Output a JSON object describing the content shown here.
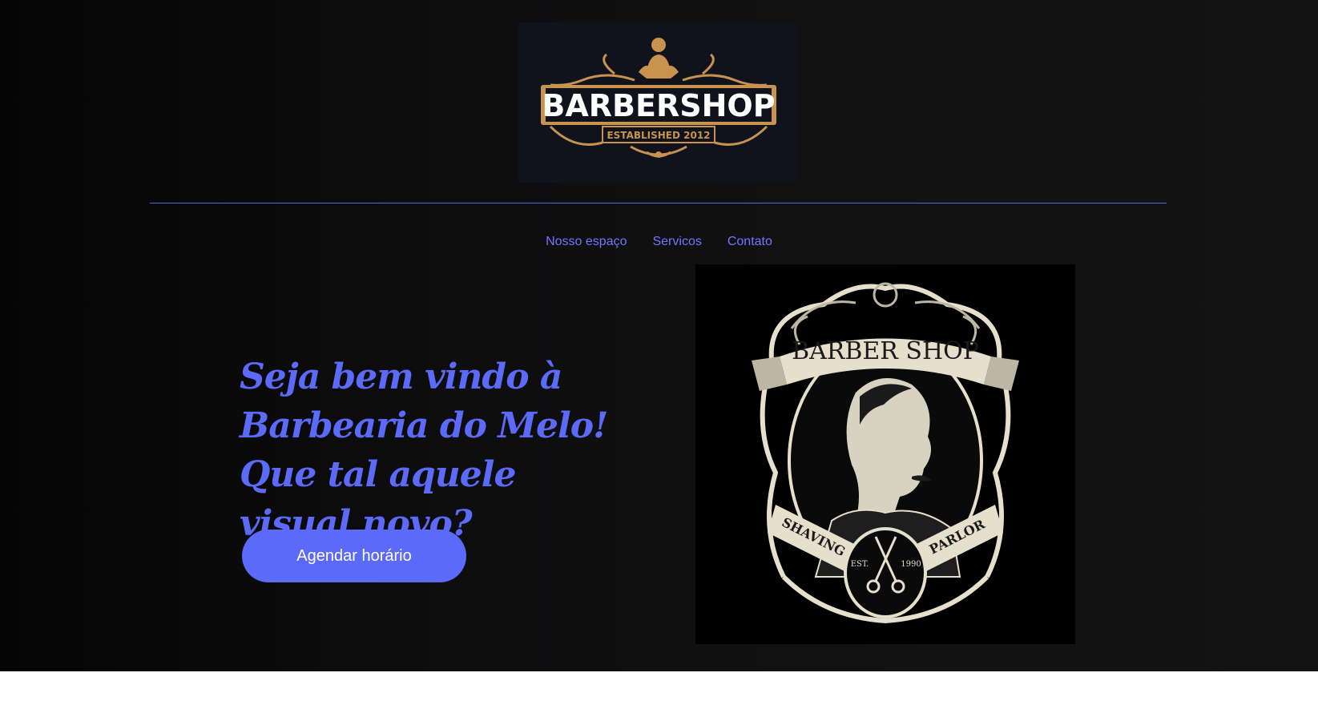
{
  "logo": {
    "title": "BARBERSHOP",
    "subtitle": "ESTABLISHED 2012"
  },
  "nav": {
    "items": [
      {
        "label": "Nosso espaço"
      },
      {
        "label": "Servicos"
      },
      {
        "label": "Contato"
      }
    ]
  },
  "hero": {
    "headline": "Seja bem vindo à Barbearia do Melo! Que tal aquele visual novo?",
    "cta_label": "Agendar horário"
  },
  "badge": {
    "title": "BARBER SHOP",
    "left_ribbon": "SHAVING",
    "right_ribbon": "PARLOR",
    "est_left": "EST.",
    "est_right": "1990"
  },
  "colors": {
    "accent": "#5b6af8",
    "nav_link": "#6f78ff",
    "gold": "#c8924f",
    "cream": "#e6dfcc"
  }
}
